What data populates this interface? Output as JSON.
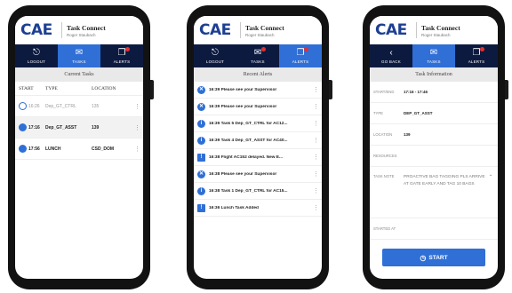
{
  "brand": {
    "logo": "CAE",
    "app_title": "Task Connect",
    "user": "Roger Staubach"
  },
  "screens": {
    "tasks": {
      "nav": [
        {
          "label": "LOGOUT",
          "icon": "logout-icon",
          "glyph": "⎋",
          "active": false
        },
        {
          "label": "TASKS",
          "icon": "tasks-icon",
          "glyph": "✉",
          "active": true,
          "badge": false
        },
        {
          "label": "ALERTS",
          "icon": "alerts-icon",
          "glyph": "❐",
          "active": false,
          "badge": true
        }
      ],
      "section_title": "Current Tasks",
      "columns": [
        "START",
        "TYPE",
        "LOCATION"
      ],
      "rows": [
        {
          "time": "16:26",
          "type": "Dep_GT_CTRL",
          "location": "135",
          "status": "outline",
          "muted": true
        },
        {
          "time": "17:16",
          "type": "Dep_GT_ASST",
          "location": "139",
          "status": "filled",
          "muted": false
        },
        {
          "time": "17:56",
          "type": "LUNCH",
          "location": "CSD_DOM",
          "status": "filled",
          "muted": false
        }
      ]
    },
    "alerts": {
      "nav": [
        {
          "label": "LOGOUT",
          "icon": "logout-icon",
          "glyph": "⎋",
          "active": false
        },
        {
          "label": "TASKS",
          "icon": "tasks-icon",
          "glyph": "✉",
          "active": false,
          "badge": true
        },
        {
          "label": "ALERTS",
          "icon": "alerts-icon",
          "glyph": "❐",
          "active": true,
          "badge": true
        }
      ],
      "section_title": "Recent Alerts",
      "rows": [
        {
          "icon": "close-circle-icon",
          "glyph": "✕",
          "shape": "circle",
          "text": "16:39 Please see your Supervisor"
        },
        {
          "icon": "close-circle-icon",
          "glyph": "✕",
          "shape": "circle",
          "text": "16:39 Please see your Supervisor"
        },
        {
          "icon": "info-icon",
          "glyph": "i",
          "shape": "circle",
          "text": "16:39 Task 5 Dep_GT_CTRL for AC12..."
        },
        {
          "icon": "info-icon",
          "glyph": "i",
          "shape": "circle",
          "text": "16:39 Task 4 Dep_GT_ASST for AC40..."
        },
        {
          "icon": "warning-icon",
          "glyph": "!",
          "shape": "square",
          "text": "16:38 Flight AC152 delayed. New E..."
        },
        {
          "icon": "close-circle-icon",
          "glyph": "✕",
          "shape": "circle",
          "text": "16:38 Please see your Supervisor"
        },
        {
          "icon": "info-icon",
          "glyph": "i",
          "shape": "circle",
          "text": "16:38 Task 1 Dep_GT_CTRL for AC15..."
        },
        {
          "icon": "warning-icon",
          "glyph": "!",
          "shape": "square",
          "text": "16:36 Lunch Task Added"
        }
      ]
    },
    "info": {
      "nav": [
        {
          "label": "GO BACK",
          "icon": "back-icon",
          "glyph": "‹",
          "active": false
        },
        {
          "label": "TASKS",
          "icon": "tasks-icon",
          "glyph": "✉",
          "active": true,
          "badge": false
        },
        {
          "label": "ALERTS",
          "icon": "alerts-icon",
          "glyph": "❐",
          "active": false,
          "badge": true
        }
      ],
      "section_title": "Task Information",
      "fields": [
        {
          "label": "START/END",
          "value": "17:16 - 17:46"
        },
        {
          "label": "TYPE",
          "value": "DEP_GT_ASST"
        },
        {
          "label": "LOCATION",
          "value": "139"
        },
        {
          "label": "RESOURCES",
          "value": ""
        }
      ],
      "note": {
        "label": "TASK NOTE",
        "value": "PROACTIVE BAG TAGGING PLS ARRIVE AT GATE EARLY AND TAG 10 BAGS"
      },
      "started": {
        "label": "STARTED AT",
        "value": ""
      },
      "start_button": "START"
    }
  },
  "colors": {
    "nav_bg": "#0d1a40",
    "accent": "#2f6fd6",
    "logo": "#1c3f93"
  }
}
